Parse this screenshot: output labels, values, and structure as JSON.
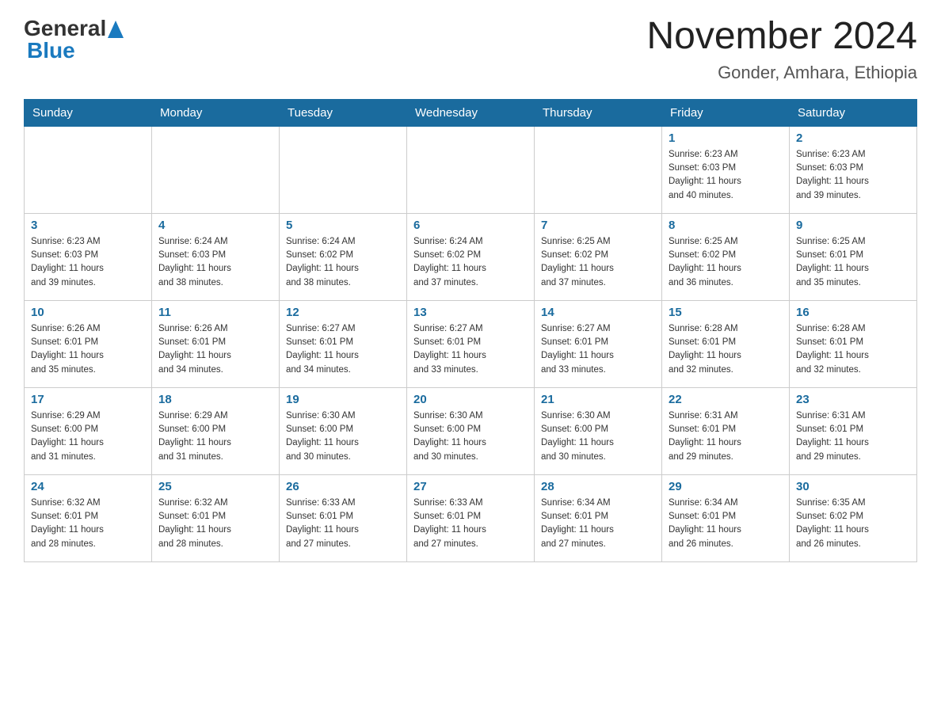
{
  "header": {
    "logo_general": "General",
    "logo_blue": "Blue",
    "title": "November 2024",
    "subtitle": "Gonder, Amhara, Ethiopia"
  },
  "calendar": {
    "days_of_week": [
      "Sunday",
      "Monday",
      "Tuesday",
      "Wednesday",
      "Thursday",
      "Friday",
      "Saturday"
    ],
    "weeks": [
      {
        "cells": [
          {
            "day": "",
            "info": ""
          },
          {
            "day": "",
            "info": ""
          },
          {
            "day": "",
            "info": ""
          },
          {
            "day": "",
            "info": ""
          },
          {
            "day": "",
            "info": ""
          },
          {
            "day": "1",
            "info": "Sunrise: 6:23 AM\nSunset: 6:03 PM\nDaylight: 11 hours\nand 40 minutes."
          },
          {
            "day": "2",
            "info": "Sunrise: 6:23 AM\nSunset: 6:03 PM\nDaylight: 11 hours\nand 39 minutes."
          }
        ]
      },
      {
        "cells": [
          {
            "day": "3",
            "info": "Sunrise: 6:23 AM\nSunset: 6:03 PM\nDaylight: 11 hours\nand 39 minutes."
          },
          {
            "day": "4",
            "info": "Sunrise: 6:24 AM\nSunset: 6:03 PM\nDaylight: 11 hours\nand 38 minutes."
          },
          {
            "day": "5",
            "info": "Sunrise: 6:24 AM\nSunset: 6:02 PM\nDaylight: 11 hours\nand 38 minutes."
          },
          {
            "day": "6",
            "info": "Sunrise: 6:24 AM\nSunset: 6:02 PM\nDaylight: 11 hours\nand 37 minutes."
          },
          {
            "day": "7",
            "info": "Sunrise: 6:25 AM\nSunset: 6:02 PM\nDaylight: 11 hours\nand 37 minutes."
          },
          {
            "day": "8",
            "info": "Sunrise: 6:25 AM\nSunset: 6:02 PM\nDaylight: 11 hours\nand 36 minutes."
          },
          {
            "day": "9",
            "info": "Sunrise: 6:25 AM\nSunset: 6:01 PM\nDaylight: 11 hours\nand 35 minutes."
          }
        ]
      },
      {
        "cells": [
          {
            "day": "10",
            "info": "Sunrise: 6:26 AM\nSunset: 6:01 PM\nDaylight: 11 hours\nand 35 minutes."
          },
          {
            "day": "11",
            "info": "Sunrise: 6:26 AM\nSunset: 6:01 PM\nDaylight: 11 hours\nand 34 minutes."
          },
          {
            "day": "12",
            "info": "Sunrise: 6:27 AM\nSunset: 6:01 PM\nDaylight: 11 hours\nand 34 minutes."
          },
          {
            "day": "13",
            "info": "Sunrise: 6:27 AM\nSunset: 6:01 PM\nDaylight: 11 hours\nand 33 minutes."
          },
          {
            "day": "14",
            "info": "Sunrise: 6:27 AM\nSunset: 6:01 PM\nDaylight: 11 hours\nand 33 minutes."
          },
          {
            "day": "15",
            "info": "Sunrise: 6:28 AM\nSunset: 6:01 PM\nDaylight: 11 hours\nand 32 minutes."
          },
          {
            "day": "16",
            "info": "Sunrise: 6:28 AM\nSunset: 6:01 PM\nDaylight: 11 hours\nand 32 minutes."
          }
        ]
      },
      {
        "cells": [
          {
            "day": "17",
            "info": "Sunrise: 6:29 AM\nSunset: 6:00 PM\nDaylight: 11 hours\nand 31 minutes."
          },
          {
            "day": "18",
            "info": "Sunrise: 6:29 AM\nSunset: 6:00 PM\nDaylight: 11 hours\nand 31 minutes."
          },
          {
            "day": "19",
            "info": "Sunrise: 6:30 AM\nSunset: 6:00 PM\nDaylight: 11 hours\nand 30 minutes."
          },
          {
            "day": "20",
            "info": "Sunrise: 6:30 AM\nSunset: 6:00 PM\nDaylight: 11 hours\nand 30 minutes."
          },
          {
            "day": "21",
            "info": "Sunrise: 6:30 AM\nSunset: 6:00 PM\nDaylight: 11 hours\nand 30 minutes."
          },
          {
            "day": "22",
            "info": "Sunrise: 6:31 AM\nSunset: 6:01 PM\nDaylight: 11 hours\nand 29 minutes."
          },
          {
            "day": "23",
            "info": "Sunrise: 6:31 AM\nSunset: 6:01 PM\nDaylight: 11 hours\nand 29 minutes."
          }
        ]
      },
      {
        "cells": [
          {
            "day": "24",
            "info": "Sunrise: 6:32 AM\nSunset: 6:01 PM\nDaylight: 11 hours\nand 28 minutes."
          },
          {
            "day": "25",
            "info": "Sunrise: 6:32 AM\nSunset: 6:01 PM\nDaylight: 11 hours\nand 28 minutes."
          },
          {
            "day": "26",
            "info": "Sunrise: 6:33 AM\nSunset: 6:01 PM\nDaylight: 11 hours\nand 27 minutes."
          },
          {
            "day": "27",
            "info": "Sunrise: 6:33 AM\nSunset: 6:01 PM\nDaylight: 11 hours\nand 27 minutes."
          },
          {
            "day": "28",
            "info": "Sunrise: 6:34 AM\nSunset: 6:01 PM\nDaylight: 11 hours\nand 27 minutes."
          },
          {
            "day": "29",
            "info": "Sunrise: 6:34 AM\nSunset: 6:01 PM\nDaylight: 11 hours\nand 26 minutes."
          },
          {
            "day": "30",
            "info": "Sunrise: 6:35 AM\nSunset: 6:02 PM\nDaylight: 11 hours\nand 26 minutes."
          }
        ]
      }
    ]
  }
}
